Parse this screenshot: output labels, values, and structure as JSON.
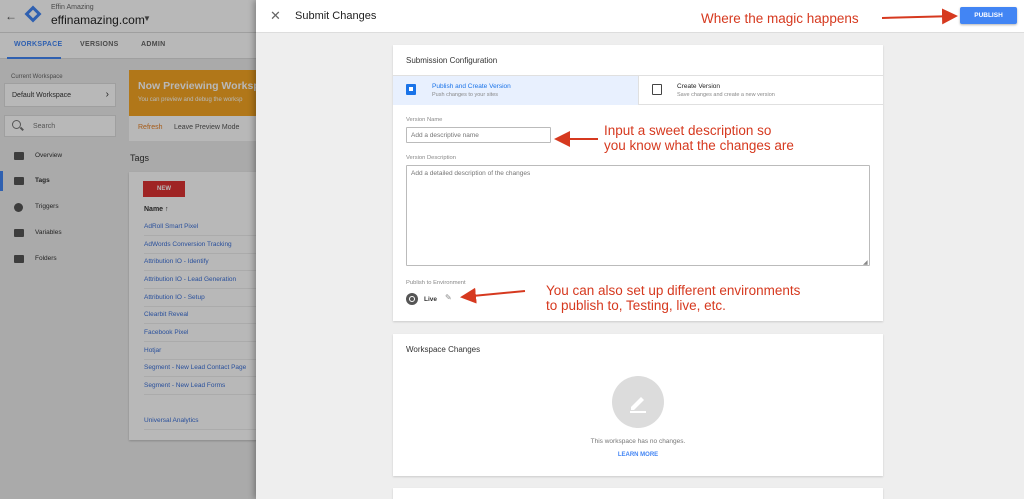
{
  "background": {
    "account_name": "Effin Amazing",
    "container_name": "effinamazing.com",
    "tabs": [
      "WORKSPACE",
      "VERSIONS",
      "ADMIN"
    ],
    "current_workspace_label": "Current Workspace",
    "workspace_name": "Default Workspace",
    "search_placeholder": "Search",
    "nav": [
      "Overview",
      "Tags",
      "Triggers",
      "Variables",
      "Folders"
    ],
    "preview": {
      "title": "Now Previewing Workspa",
      "subtitle": "You can preview and debug the worksp",
      "refresh": "Refresh",
      "leave": "Leave Preview Mode"
    },
    "tags_title": "Tags",
    "new_button": "NEW",
    "name_column": "Name ↑",
    "tag_rows": [
      "AdRoll Smart Pixel",
      "AdWords Conversion Tracking",
      "Attribution IO - Identify",
      "Attribution IO - Lead Generation",
      "Attribution IO - Setup",
      "Clearbit Reveal",
      "Facebook Pixel",
      "Hotjar",
      "Segment - New Lead Contact Page",
      "Segment - New Lead Forms",
      "Universal Analytics"
    ]
  },
  "panel": {
    "title": "Submit Changes",
    "publish_label": "PUBLISH",
    "submission_config_title": "Submission Configuration",
    "options": [
      {
        "title": "Publish and Create Version",
        "subtitle": "Push changes to your sites"
      },
      {
        "title": "Create Version",
        "subtitle": "Save changes and create a new version"
      }
    ],
    "version_name_label": "Version Name",
    "version_name_placeholder": "Add a descriptive name",
    "version_description_label": "Version Description",
    "version_description_placeholder": "Add a detailed description of the changes",
    "publish_env_label": "Publish to Environment",
    "environment": "Live",
    "workspace_changes_title": "Workspace Changes",
    "no_changes_text": "This workspace has no changes.",
    "learn_more": "LEARN MORE"
  },
  "annotations": {
    "publish": "Where the magic happens",
    "description_line1": "Input a sweet description so",
    "description_line2": "you know what the changes are",
    "environments_line1": "You can also set up different environments",
    "environments_line2": "to publish to, Testing, live, etc."
  },
  "colors": {
    "accent": "#4285f4",
    "annotation": "#d6391f",
    "preview_banner": "#f5a623",
    "new_button": "#dd3333"
  }
}
